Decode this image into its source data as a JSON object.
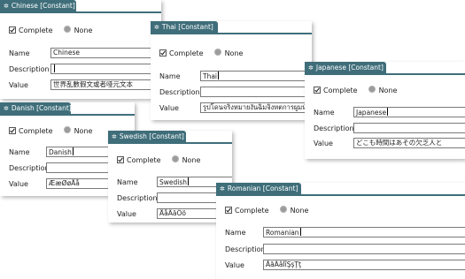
{
  "labels": {
    "complete": "Complete",
    "none": "None",
    "name": "Name",
    "description": "Description",
    "value": "Value"
  },
  "icons": {
    "tab": "gear-icon",
    "checkbox": "checkmark-icon",
    "radio": "radio-button-icon"
  },
  "colors": {
    "tab_background": "#3f6e7a",
    "tab_text": "#ffffff",
    "radio_fill": "#9c9c9c"
  },
  "panels": [
    {
      "tab": "Chinese [Constant]",
      "name": "Chinese",
      "description": "",
      "value": "世界乱數假文或者哑元文本",
      "complete": true,
      "none": false
    },
    {
      "tab": "Thai [Constant]",
      "name": "Thai",
      "description": "",
      "value": "รูปโดนจริงหมายงันฉิมจิงหตการผูมห์",
      "complete": true,
      "none": false
    },
    {
      "tab": "Japanese [Constant]",
      "name": "Japanese",
      "description": "",
      "value": "どこも時間はあその欠乏人と",
      "complete": true,
      "none": false
    },
    {
      "tab": "Danish [Constant]",
      "name": "Danish",
      "description": "",
      "value": "ÆæØøÅå",
      "complete": true,
      "none": false
    },
    {
      "tab": "Swedish [Constant]",
      "name": "Swedish",
      "description": "",
      "value": "ÅåÄäÖö",
      "complete": true,
      "none": false
    },
    {
      "tab": "Romanian [Constant]",
      "name": "Romanian",
      "description": "",
      "value": "ĂăÂâÎîŞşŢţ",
      "complete": true,
      "none": false
    }
  ]
}
